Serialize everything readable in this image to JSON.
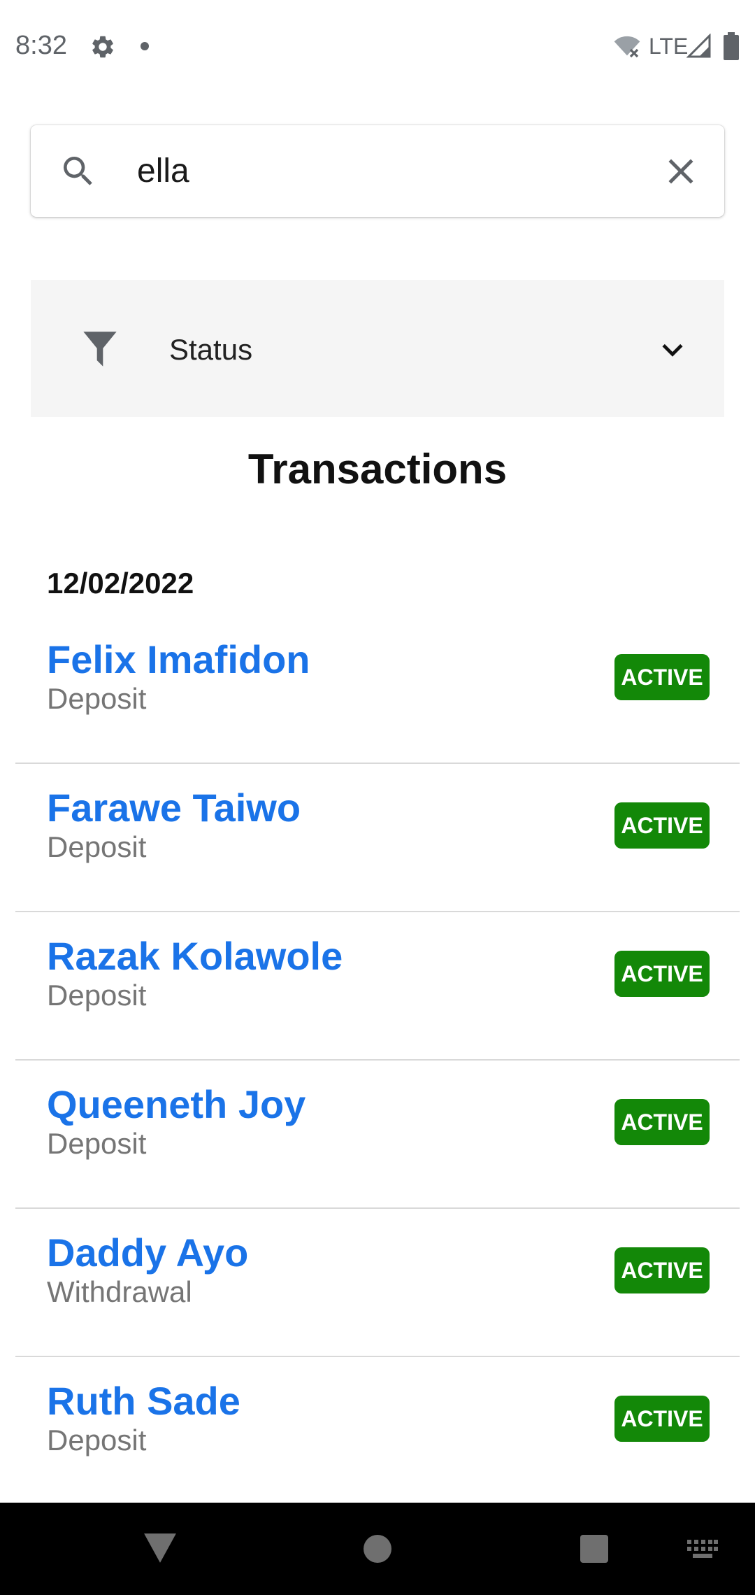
{
  "status_bar": {
    "time": "8:32",
    "network": "LTE",
    "icons": [
      "gear-icon",
      "notification-dot",
      "wifi-off-icon",
      "signal-icon",
      "battery-icon"
    ]
  },
  "search": {
    "value": "ella",
    "icon": "search-icon",
    "clear_icon": "close-icon"
  },
  "filter": {
    "label": "Status",
    "icon": "filter-icon",
    "dropdown_icon": "chevron-down-icon"
  },
  "page": {
    "title": "Transactions"
  },
  "transactions": {
    "date": "12/02/2022",
    "items": [
      {
        "name": "Felix Imafidon",
        "type": "Deposit",
        "status": "ACTIVE"
      },
      {
        "name": "Farawe Taiwo",
        "type": "Deposit",
        "status": "ACTIVE"
      },
      {
        "name": "Razak Kolawole",
        "type": "Deposit",
        "status": "ACTIVE"
      },
      {
        "name": "Queeneth Joy",
        "type": "Deposit",
        "status": "ACTIVE"
      },
      {
        "name": "Daddy Ayo",
        "type": "Withdrawal",
        "status": "ACTIVE"
      },
      {
        "name": "Ruth Sade",
        "type": "Deposit",
        "status": "ACTIVE"
      }
    ]
  },
  "colors": {
    "name_link": "#1a73e8",
    "status_active": "#138808",
    "filter_background": "#f5f5f5",
    "nav_background": "#000000"
  },
  "nav_bar": {
    "icons": [
      "back-icon",
      "home-icon",
      "recents-icon",
      "keyboard-icon"
    ]
  }
}
